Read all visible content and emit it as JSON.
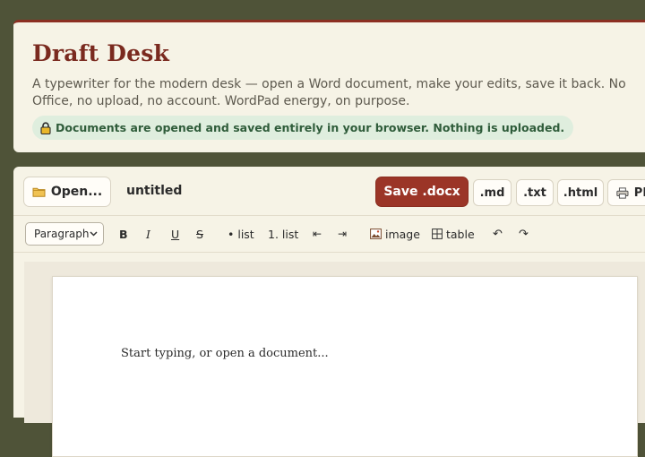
{
  "header": {
    "title": "Draft Desk",
    "tagline": "A typewriter for the modern desk — open a Word document, make your edits, save it back. No Office, no upload, no account. WordPad energy, on purpose.",
    "notice_icon": "lock-icon",
    "notice": "Documents are opened and saved entirely in your browser. Nothing is uploaded."
  },
  "toolbar": {
    "open_label": "Open...",
    "open_icon": "folder-icon",
    "doc_name": "untitled",
    "save_label": "Save .docx",
    "export_md": ".md",
    "export_txt": ".txt",
    "export_html": ".html",
    "export_pdf": "PDF",
    "pdf_icon": "printer-icon"
  },
  "format": {
    "block_style": "Paragraph",
    "bold": "B",
    "italic": "I",
    "underline": "U",
    "strike": "S",
    "bullet_list": "• list",
    "numbered_list": "1. list",
    "outdent": "⇤",
    "indent": "⇥",
    "image": "image",
    "table": "table",
    "undo": "↶",
    "redo": "↷"
  },
  "document": {
    "placeholder": "Start typing, or open a document..."
  },
  "colors": {
    "background": "#4f5338",
    "card": "#f6f3e6",
    "accent": "#9b3527",
    "title": "#7a2a1f",
    "notice_bg": "#dfeede",
    "notice_text": "#2f5c3a"
  }
}
